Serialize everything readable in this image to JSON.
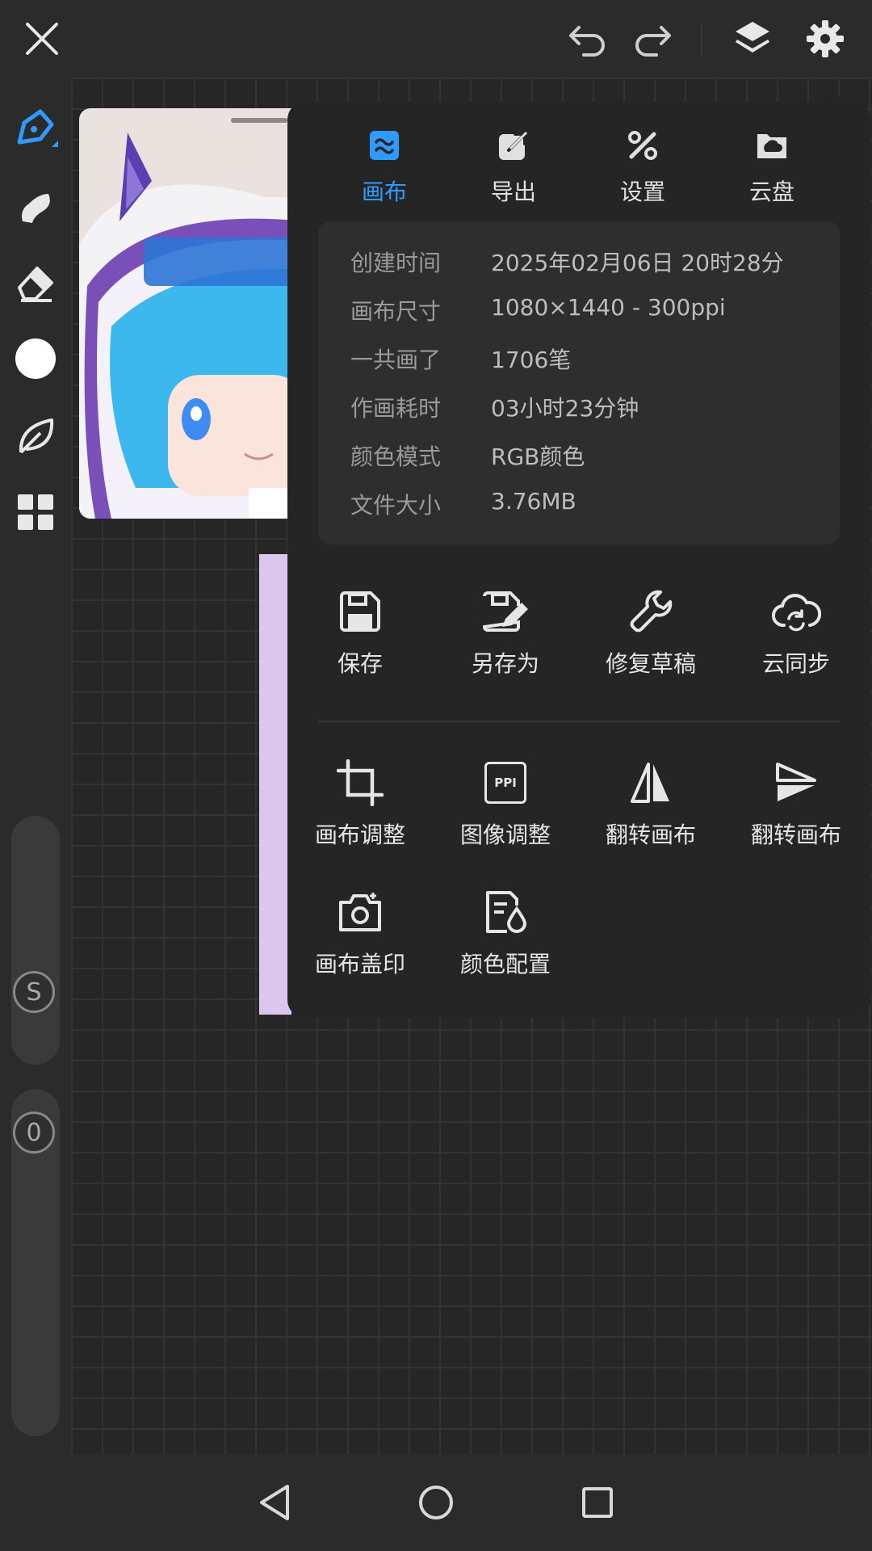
{
  "toolbar": {
    "close": "close-icon",
    "undo": "undo-icon",
    "redo": "redo-icon",
    "layers": "layers-icon",
    "settings": "gear-icon"
  },
  "left_tools": [
    "pen-icon",
    "smudge-icon",
    "eraser-icon",
    "color-swatch",
    "leaf-icon",
    "grid-icon"
  ],
  "sliders": {
    "size_label": "S",
    "opacity_label": "0"
  },
  "panel": {
    "tabs": [
      {
        "label": "画布",
        "icon": "canvas-icon",
        "active": true
      },
      {
        "label": "导出",
        "icon": "export-icon",
        "active": false
      },
      {
        "label": "设置",
        "icon": "settings-tools-icon",
        "active": false
      },
      {
        "label": "云盘",
        "icon": "cloud-drive-icon",
        "active": false
      }
    ],
    "info": [
      {
        "key": "创建时间",
        "value": "2025年02月06日 20时28分"
      },
      {
        "key": "画布尺寸",
        "value": "1080×1440 - 300ppi"
      },
      {
        "key": "一共画了",
        "value": "1706笔"
      },
      {
        "key": "作画耗时",
        "value": "03小时23分钟"
      },
      {
        "key": "颜色模式",
        "value": "RGB颜色"
      },
      {
        "key": "文件大小",
        "value": "3.76MB"
      }
    ],
    "actions_row1": [
      {
        "label": "保存",
        "icon": "save-icon"
      },
      {
        "label": "另存为",
        "icon": "save-as-icon"
      },
      {
        "label": "修复草稿",
        "icon": "wrench-icon"
      },
      {
        "label": "云同步",
        "icon": "cloud-sync-icon"
      }
    ],
    "actions_row2": [
      {
        "label": "画布调整",
        "icon": "crop-icon"
      },
      {
        "label": "图像调整",
        "icon": "ppi-icon",
        "icon_text": "PPI"
      },
      {
        "label": "翻转画布",
        "icon": "flip-horizontal-icon"
      },
      {
        "label": "翻转画布",
        "icon": "flip-vertical-icon"
      }
    ],
    "actions_row3": [
      {
        "label": "画布盖印",
        "icon": "camera-icon"
      },
      {
        "label": "颜色配置",
        "icon": "color-profile-icon"
      }
    ]
  },
  "colors": {
    "accent": "#2f9bff",
    "panel": "#252525",
    "background": "#2b2b2b"
  }
}
